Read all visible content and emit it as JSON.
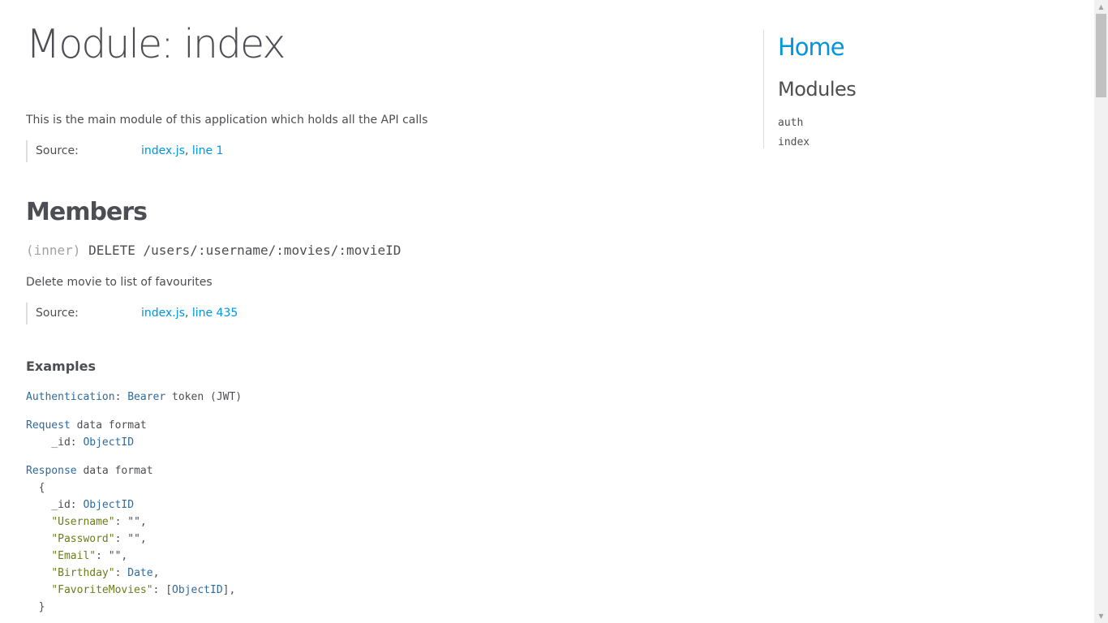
{
  "page": {
    "title": "Module: index",
    "description": "This is the main module of this application which holds all the API calls",
    "source": {
      "label": "Source:",
      "file": "index.js",
      "sep": ", ",
      "line": "line 1"
    }
  },
  "members": {
    "heading": "Members",
    "item": {
      "scope": "(inner)",
      "name": "DELETE /users/:username/:movies/:movieID",
      "description": "Delete movie to list of favourites",
      "source": {
        "label": "Source:",
        "file": "index.js",
        "sep": ", ",
        "line": "line 435"
      },
      "examples_heading": "Examples",
      "code": {
        "l1": {
          "a": "Authentication",
          "b": ": ",
          "c": "Bearer",
          "d": " token (JWT)"
        },
        "l2": {
          "a": "Request",
          "b": " data format"
        },
        "l3": {
          "a": "    _id: ",
          "b": "ObjectID"
        },
        "l4": {
          "a": "Response",
          "b": " data format"
        },
        "l5": {
          "a": "  {"
        },
        "l6": {
          "a": "    _id: ",
          "b": "ObjectID"
        },
        "l7": {
          "a": "    ",
          "b": "\"Username\"",
          "c": ": \"\","
        },
        "l8": {
          "a": "    ",
          "b": "\"Password\"",
          "c": ": \"\","
        },
        "l9": {
          "a": "    ",
          "b": "\"Email\"",
          "c": ": \"\","
        },
        "l10": {
          "a": "    ",
          "b": "\"Birthday\"",
          "c": ": ",
          "d": "Date",
          "e": ","
        },
        "l11": {
          "a": "    ",
          "b": "\"FavoriteMovies\"",
          "c": ": [",
          "d": "ObjectID",
          "e": "],"
        },
        "l12": {
          "a": "  }"
        }
      }
    }
  },
  "nav": {
    "home": "Home",
    "heading": "Modules",
    "items": [
      "auth",
      "index"
    ]
  },
  "scrollbar": {
    "up_icon": "▲",
    "down_icon": "▼"
  }
}
